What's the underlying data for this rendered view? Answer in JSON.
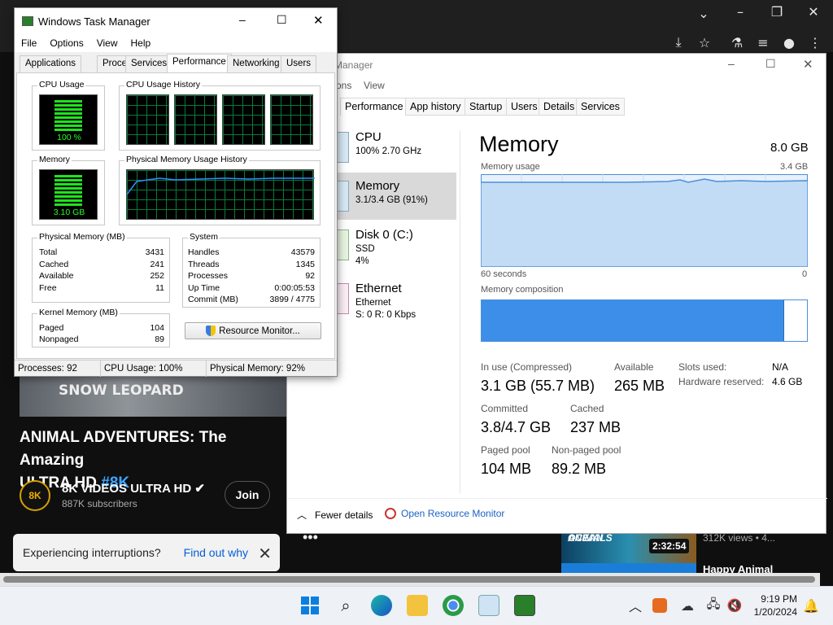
{
  "browser": {
    "icons": [
      "dropdown-icon",
      "minimize-icon",
      "restore-icon",
      "close-icon",
      "install-icon",
      "star-icon",
      "flask-icon",
      "playlist-icon",
      "profile-icon",
      "menu-icon"
    ]
  },
  "youtube": {
    "thumb_text": "SNOW LEOPARD",
    "title_line1": "ANIMAL ADVENTURES: The Amazing",
    "title_line2": "ULTRA HD",
    "title_tag": "#8K",
    "channel_logo": "8K",
    "channel_name": "8K VIDEOS ULTRA HD",
    "subscribers": "887K subscribers",
    "join_label": "Join",
    "toast_text": "Experiencing interruptions?",
    "toast_link": "Find out why",
    "side_thumb_text_1": "OCEAN",
    "side_thumb_text_2": "ANIMALS",
    "side_duration": "2:32:54",
    "side_views": "312K views • 4...",
    "side_title2": "Happy Animal"
  },
  "old_tm": {
    "title": "Windows Task Manager",
    "menu": [
      "File",
      "Options",
      "View",
      "Help"
    ],
    "tabs": [
      "Applications",
      "Processes",
      "Services",
      "Performance",
      "Networking",
      "Users"
    ],
    "active_tab": "Performance",
    "cpu_usage_label": "CPU Usage",
    "cpu_usage_value": "100 %",
    "cpu_history_label": "CPU Usage History",
    "memory_label": "Memory",
    "memory_value": "3.10 GB",
    "phys_history_label": "Physical Memory Usage History",
    "physical_memory": {
      "heading": "Physical Memory (MB)",
      "rows": [
        {
          "k": "Total",
          "v": "3431"
        },
        {
          "k": "Cached",
          "v": "241"
        },
        {
          "k": "Available",
          "v": "252"
        },
        {
          "k": "Free",
          "v": "11"
        }
      ]
    },
    "system": {
      "heading": "System",
      "rows": [
        {
          "k": "Handles",
          "v": "43579"
        },
        {
          "k": "Threads",
          "v": "1345"
        },
        {
          "k": "Processes",
          "v": "92"
        },
        {
          "k": "Up Time",
          "v": "0:00:05:53"
        },
        {
          "k": "Commit (MB)",
          "v": "3899 / 4775"
        }
      ]
    },
    "kernel_memory": {
      "heading": "Kernel Memory (MB)",
      "rows": [
        {
          "k": "Paged",
          "v": "104"
        },
        {
          "k": "Nonpaged",
          "v": "89"
        }
      ]
    },
    "resource_monitor_button": "Resource Monitor...",
    "status": {
      "processes": "Processes: 92",
      "cpu": "CPU Usage: 100%",
      "memory": "Physical Memory: 92%"
    }
  },
  "new_tm": {
    "title": "Manager",
    "menu": [
      "ons",
      "View"
    ],
    "tabs": [
      "Performance",
      "App history",
      "Startup",
      "Users",
      "Details",
      "Services"
    ],
    "sidebar": [
      {
        "name": "CPU",
        "sub1": "100% 2.70 GHz",
        "sub2": ""
      },
      {
        "name": "Memory",
        "sub1": "3.1/3.4 GB (91%)",
        "sub2": ""
      },
      {
        "name": "Disk 0 (C:)",
        "sub1": "SSD",
        "sub2": "4%"
      },
      {
        "name": "Ethernet",
        "sub1": "Ethernet",
        "sub2": "S: 0 R: 0 Kbps"
      }
    ],
    "heading": "Memory",
    "total": "8.0 GB",
    "usage_label": "Memory usage",
    "usage_max": "3.4 GB",
    "axis_left": "60 seconds",
    "axis_right": "0",
    "composition_label": "Memory composition",
    "composition_fill": 0.93,
    "stats": {
      "in_use_label": "In use (Compressed)",
      "in_use_value": "3.1 GB (55.7 MB)",
      "available_label": "Available",
      "available_value": "265 MB",
      "committed_label": "Committed",
      "committed_value": "3.8/4.7 GB",
      "cached_label": "Cached",
      "cached_value": "237 MB",
      "paged_label": "Paged pool",
      "paged_value": "104 MB",
      "nonpaged_label": "Non-paged pool",
      "nonpaged_value": "89.2 MB",
      "slots_label": "Slots used:",
      "slots_value": "N/A",
      "hw_label": "Hardware reserved:",
      "hw_value": "4.6 GB"
    },
    "fewer_details": "Fewer details",
    "open_resource_monitor": "Open Resource Monitor"
  },
  "taskbar": {
    "time": "9:19 PM",
    "date": "1/20/2024"
  }
}
